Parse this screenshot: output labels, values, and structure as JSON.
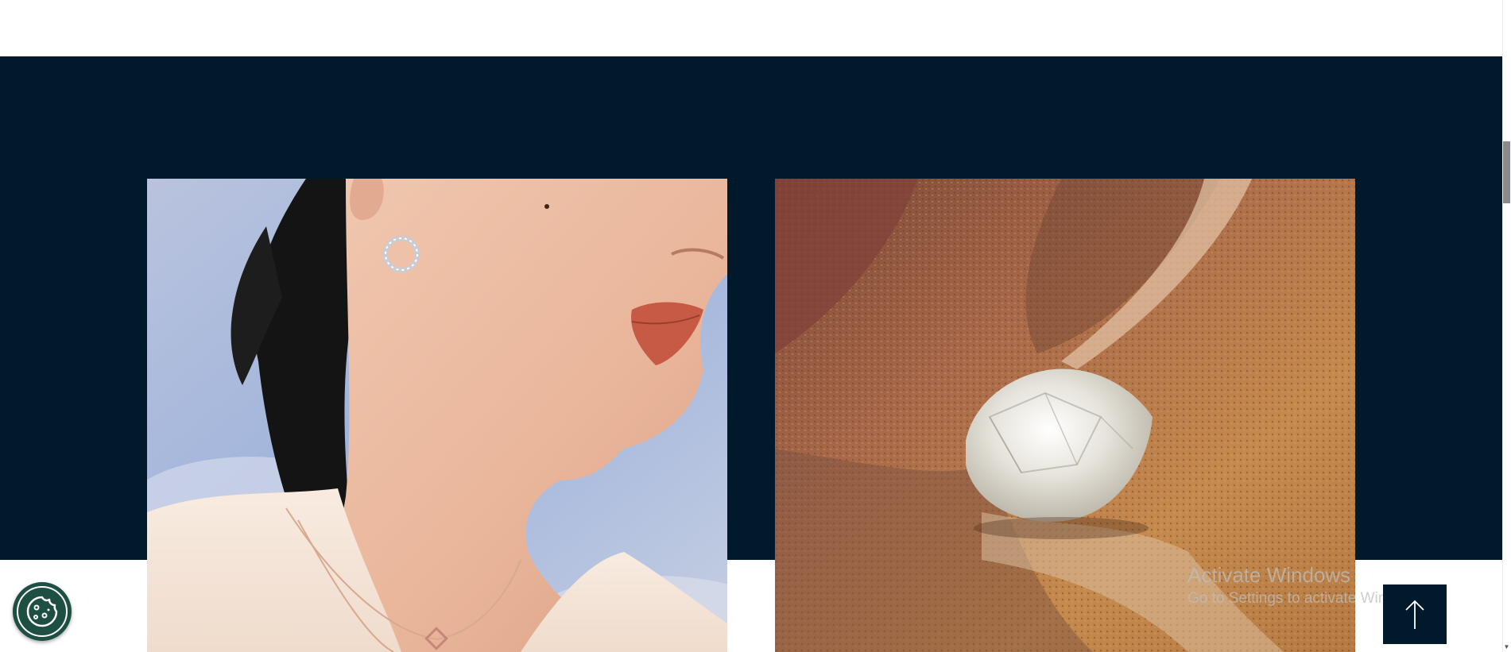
{
  "section": {
    "band_color": "#00192b",
    "page_background": "#ffffff"
  },
  "images": [
    {
      "name": "woman-profile-jewelry-photo",
      "description_icon": "photo"
    },
    {
      "name": "rough-diamond-on-rock-photo",
      "description_icon": "photo"
    }
  ],
  "cookie_button": {
    "icon": "cookie-icon",
    "color": "#1d4f43"
  },
  "back_to_top": {
    "icon": "arrow-up-icon",
    "color": "#00192b"
  },
  "windows_watermark": {
    "title": "Activate Windows",
    "subtitle": "Go to Settings to activate Windows."
  }
}
